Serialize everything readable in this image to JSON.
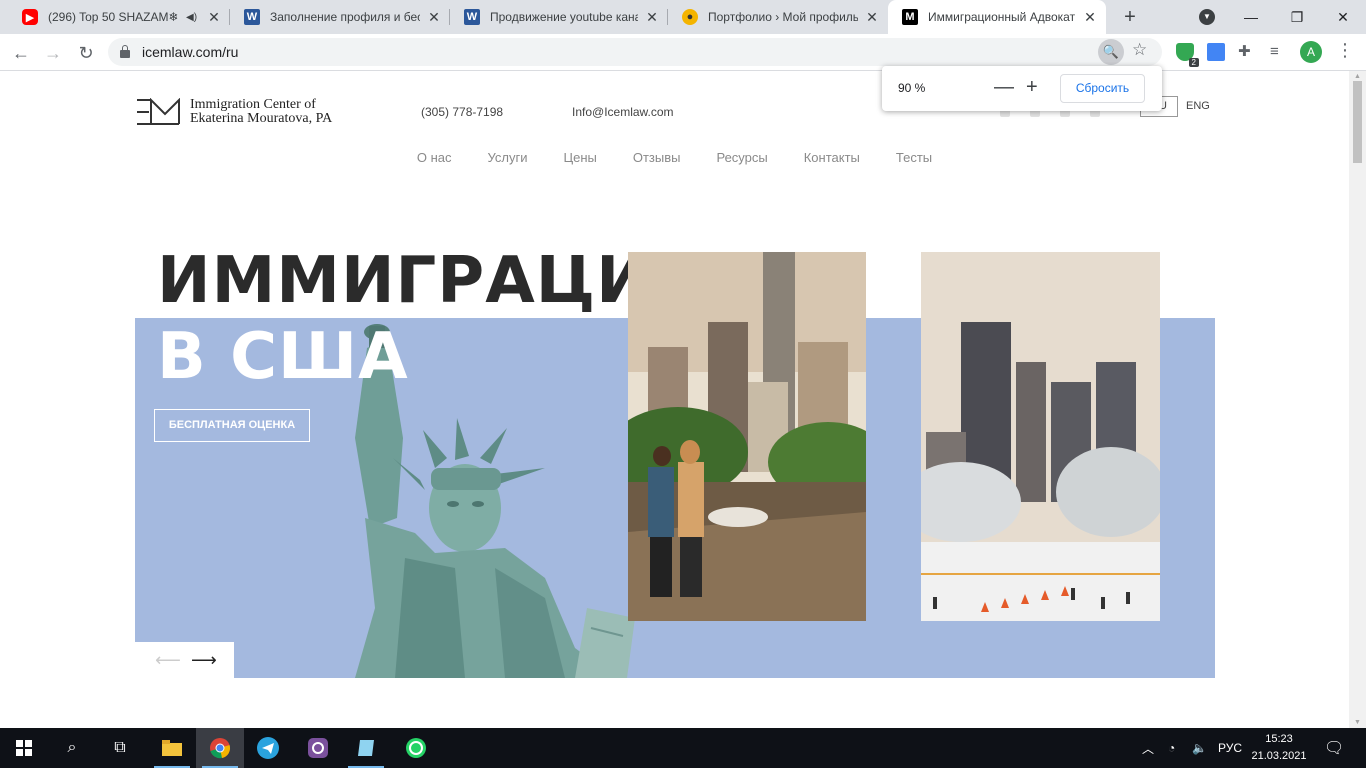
{
  "browser": {
    "tabs": [
      {
        "title": "(296) Top 50 SHAZAM❄",
        "favicon": "youtube-icon",
        "audio": true,
        "close": "✕"
      },
      {
        "title": "Заполнение профиля и бесп",
        "favicon": "word-icon",
        "close": "✕"
      },
      {
        "title": "Продвижение youtube кана",
        "favicon": "word-icon",
        "close": "✕"
      },
      {
        "title": "Портфолио › Мой профиль",
        "favicon": "portfolio-icon",
        "close": "✕"
      },
      {
        "title": "Иммиграционный Адвокат",
        "favicon": "site-m-icon",
        "favicon_letter": "M",
        "close": "✕",
        "active": true
      }
    ],
    "new_tab": "+",
    "url": "icemlaw.com/ru",
    "profile_initial": "A",
    "extension_badge": "2"
  },
  "zoom_popup": {
    "level": "90 %",
    "minus": "—",
    "plus": "+",
    "reset_label": "Сбросить"
  },
  "site": {
    "logo_line1": "Immigration Center of",
    "logo_line2": "Ekaterina Mouratova, PA",
    "phone": "(305) 778-7198",
    "email": "Info@Icemlaw.com",
    "lang_ru": "RU",
    "lang_en": "ENG",
    "nav": [
      "О нас",
      "Услуги",
      "Цены",
      "Отзывы",
      "Ресурсы",
      "Контакты",
      "Тесты"
    ],
    "hero_line1": "ИММИГРАЦИЯ",
    "hero_line2": "В США",
    "hero_button": "БЕСПЛАТНАЯ ОЦЕНКА",
    "arrow_prev": "⟵",
    "arrow_next": "⟶"
  },
  "taskbar": {
    "lang": "РУС",
    "time": "15:23",
    "date": "21.03.2021"
  },
  "colors": {
    "hero_band": "#a4b9df",
    "chrome_tabstrip": "#dee1e6",
    "accent_blue": "#1a73e8",
    "taskbar": "#0e1117"
  }
}
